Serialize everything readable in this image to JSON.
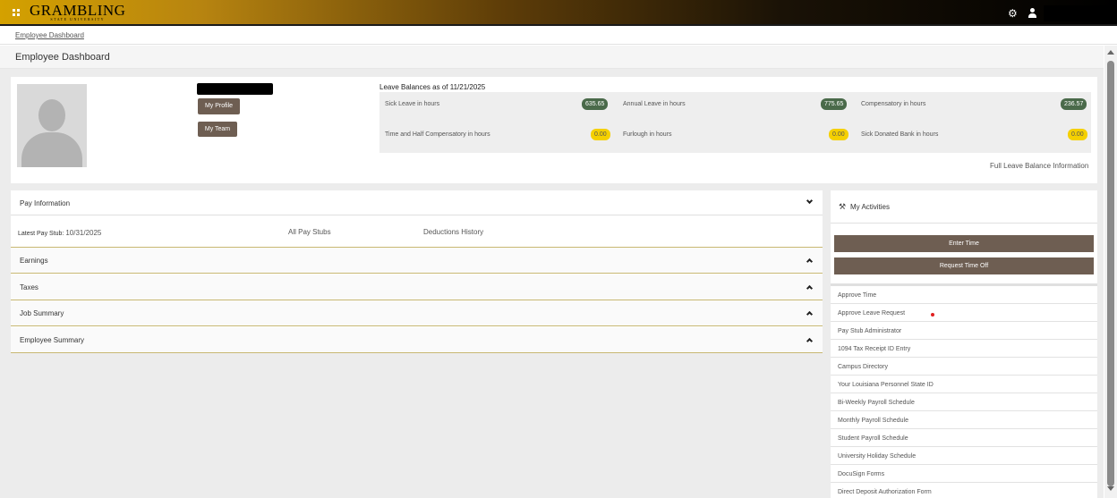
{
  "app": {
    "logo_text": "GRAMBLING",
    "logo_subtext": "STATE UNIVERSITY"
  },
  "breadcrumb": {
    "label": "Employee Dashboard"
  },
  "page": {
    "title": "Employee Dashboard"
  },
  "profile": {
    "my_profile_label": "My Profile",
    "my_team_label": "My Team"
  },
  "leave": {
    "title": "Leave Balances as of 11/21/2025",
    "items": [
      {
        "label": "Sick Leave in hours",
        "value": "635.65",
        "color": "#4a6a4a"
      },
      {
        "label": "Annual Leave in hours",
        "value": "775.65",
        "color": "#4a6a4a"
      },
      {
        "label": "Compensatory in hours",
        "value": "236.57",
        "color": "#4a6a4a"
      },
      {
        "label": "Time and Half Compensatory in hours",
        "value": "0.00",
        "color": "#f5d000"
      },
      {
        "label": "Furlough in hours",
        "value": "0.00",
        "color": "#f5d000"
      },
      {
        "label": "Sick Donated Bank in hours",
        "value": "0.00",
        "color": "#f5d000"
      }
    ],
    "full_link": "Full Leave Balance Information"
  },
  "pay": {
    "title": "Pay Information",
    "latest_stub_label": "Latest Pay Stub:",
    "latest_stub_date": "10/31/2025",
    "all_stubs_link": "All Pay Stubs",
    "deductions_link": "Deductions History",
    "sections": [
      "Earnings",
      "Taxes",
      "Job Summary",
      "Employee Summary"
    ]
  },
  "activities": {
    "title": "My Activities",
    "enter_time_label": "Enter Time",
    "request_time_off_label": "Request Time Off",
    "items": [
      "Approve Time",
      "Approve Leave Request",
      "Pay Stub Administrator",
      "1094 Tax Receipt ID Entry",
      "Campus Directory",
      "Your Louisiana Personnel State ID",
      "Bi-Weekly Payroll Schedule",
      "Monthly Payroll Schedule",
      "Student Payroll Schedule",
      "University Holiday Schedule",
      "DocuSign Forms",
      "Direct Deposit Authorization Form"
    ]
  },
  "colors": {
    "accent_gold": "#d4a100",
    "button_brown": "#6e5e52",
    "badge_green": "#4a6a4a",
    "badge_yellow": "#f5d000"
  }
}
